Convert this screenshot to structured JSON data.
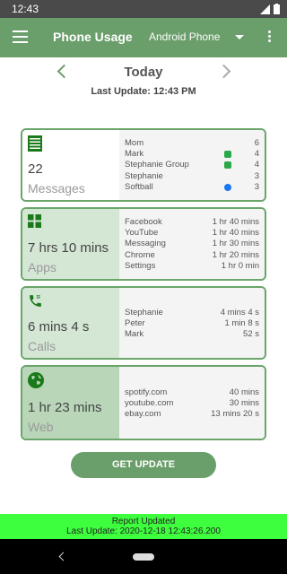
{
  "status_bar": {
    "time": "12:43"
  },
  "app_bar": {
    "title": "Phone Usage",
    "device": "Android Phone",
    "icons": [
      "menu-icon",
      "dropdown-icon",
      "overflow-icon"
    ]
  },
  "date_nav": {
    "label": "Today",
    "last_update": "Last Update: 12:43 PM"
  },
  "cards": {
    "messages": {
      "icon": "messages-icon",
      "value": "22",
      "category": "Messages",
      "rows": [
        {
          "name": "Mom",
          "val": "6",
          "badge": ""
        },
        {
          "name": "Mark",
          "val": "4",
          "badge": "whatsapp"
        },
        {
          "name": "Stephanie Group",
          "val": "4",
          "badge": "whatsapp"
        },
        {
          "name": "Stephanie",
          "val": "3",
          "badge": ""
        },
        {
          "name": "Softball",
          "val": "3",
          "badge": "messenger"
        }
      ]
    },
    "apps": {
      "icon": "apps-grid-icon",
      "value": "7 hrs 10 mins",
      "category": "Apps",
      "rows": [
        {
          "name": "Facebook",
          "val": "1 hr 40 mins"
        },
        {
          "name": "YouTube",
          "val": "1 hr 40 mins"
        },
        {
          "name": "Messaging",
          "val": "1 hr 30 mins"
        },
        {
          "name": "Chrome",
          "val": "1 hr 20 mins"
        },
        {
          "name": "Settings",
          "val": "1 hr 0 min"
        }
      ]
    },
    "calls": {
      "icon": "phone-icon",
      "value": "6 mins 4 s",
      "category": "Calls",
      "rows": [
        {
          "name": "Stephanie",
          "val": "4 mins 4 s"
        },
        {
          "name": "Peter",
          "val": "1 min 8 s"
        },
        {
          "name": "Mark",
          "val": "52 s"
        }
      ]
    },
    "web": {
      "icon": "globe-icon",
      "value": "1 hr 23 mins",
      "category": "Web",
      "rows": [
        {
          "name": "spotify.com",
          "val": "40 mins"
        },
        {
          "name": "youtube.com",
          "val": "30 mins"
        },
        {
          "name": "ebay.com",
          "val": "13 mins 20 s"
        }
      ]
    }
  },
  "get_update_label": "GET UPDATE",
  "report": {
    "title": "Report Updated",
    "detail": "Last Update: 2020-12-18 12:43:26.200"
  },
  "colors": {
    "accent": "#6a9e6a",
    "card_border": "#6aa56a",
    "report_bar": "#3dff3d",
    "status_bar": "#4a4a4a"
  }
}
